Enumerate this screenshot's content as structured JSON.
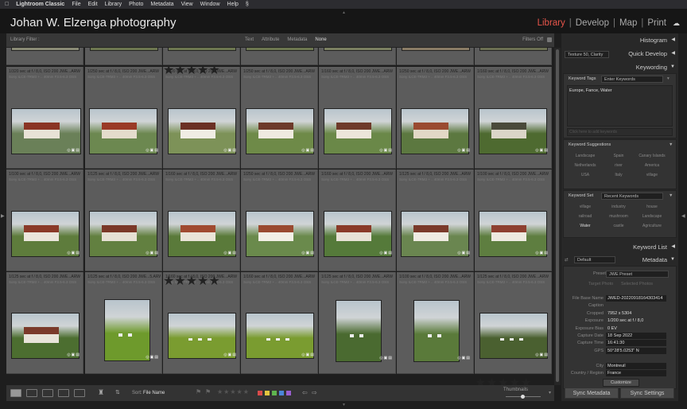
{
  "menubar": {
    "app": "Lightroom Classic",
    "items": [
      "File",
      "Edit",
      "Library",
      "Photo",
      "Metadata",
      "View",
      "Window",
      "Help"
    ]
  },
  "header": {
    "identity_plate": "Johan W. Elzenga photography",
    "modules": [
      "Library",
      "Develop",
      "Map",
      "Print"
    ],
    "separator": "|"
  },
  "filter_bar": {
    "label": "Library Filter :",
    "options": [
      "Text",
      "Attribute",
      "Metadata",
      "None"
    ],
    "selected": "None",
    "filters_off": "Filters Off"
  },
  "grid_rows": [
    {
      "meta1": "",
      "meta2": "",
      "cells": [
        {
          "stars": "",
          "bg": "#8a8b76"
        },
        {
          "stars": "",
          "bg": "#6d7750"
        },
        {
          "stars": "★★★★★",
          "bg": "#6d7750"
        },
        {
          "stars": "",
          "bg": "#6d7750"
        },
        {
          "stars": "",
          "bg": "#7b8061"
        },
        {
          "stars": "",
          "bg": "#8a7c66"
        },
        {
          "stars": "",
          "bg": "#6b6f52"
        }
      ]
    },
    {
      "cells": [
        {
          "meta1": "1/320 sec at f / 8,0, ISO 200",
          "code": "JWE...ARW",
          "meta2": "Sony ILCE-7RM3 + .. 40mm F3.5-6.3 OSS",
          "bg": "#6a8058",
          "roof": "#8a3424",
          "wall": "#e8e2d6"
        },
        {
          "meta1": "1/250 sec at f / 8,0, ISO 200",
          "code": "JWE...ARW",
          "meta2": "Sony ILCE-7RM3 + .. 40mm F3.5-6.3 OSS",
          "bg": "#6c8850",
          "roof": "#9a3a26",
          "wall": "#e4dccc"
        },
        {
          "meta1": "1/320 sec at f / 8,0, ISO 200",
          "code": "JWE...ARW",
          "meta2": "Sony ILCE-7RM3 + .. 40mm F3.5-6.3 OSS",
          "bg": "#7d9258",
          "roof": "#6b3024",
          "wall": "#f0ede4"
        },
        {
          "meta1": "1/250 sec at f / 8,0, ISO 200",
          "code": "JWE...ARW",
          "meta2": "Sony ILCE-7RM3 + .. 40mm F3.5-6.3 OSS",
          "bg": "#6e8a48",
          "roof": "#6d3a2a",
          "wall": "#efeae0"
        },
        {
          "meta1": "1/160 sec at f / 8,0, ISO 200",
          "code": "JWE...ARW",
          "meta2": "Sony ILCE-7RM3 + .. 40mm F3.5-6.3 OSS",
          "bg": "#6a8848",
          "roof": "#6e3a2a",
          "wall": "#ece6da"
        },
        {
          "meta1": "1/250 sec at f / 8,0, ISO 200",
          "code": "JWE...ARW",
          "meta2": "Sony ILCE-7RM3 + .. 40mm F3.5-6.3 OSS",
          "bg": "#5c7840",
          "roof": "#9a4a30",
          "wall": "#e2d8c6"
        },
        {
          "meta1": "1/160 sec at f / 8,0, ISO 200",
          "code": "JWE...ARW",
          "meta2": "Sony ILCE-7RM3 + .. 40mm F3.5-6.3 OSS",
          "bg": "#4e6a30",
          "roof": "#4a4a3a",
          "wall": "#dad5c8"
        }
      ]
    },
    {
      "cells": [
        {
          "meta1": "1/100 sec at f / 8,0, ISO 200",
          "code": "JWE...ARW",
          "meta2": "Sony ILCE-7RM3 + .. 40mm F3.5-6.3 OSS",
          "bg": "#5e7c3c",
          "roof": "#8a3a28",
          "wall": "#ebe6dc"
        },
        {
          "meta1": "1/125 sec at f / 8,0, ISO 200",
          "code": "JWE...ARW",
          "meta2": "Sony ILCE-7RM3 + .. 40mm F3.5-6.3 OSS",
          "bg": "#628040",
          "roof": "#7a3828",
          "wall": "#e6e0d4"
        },
        {
          "meta1": "1/160 sec at f / 8,0, ISO 200",
          "code": "JWE...ARW",
          "meta2": "Sony ILCE-7RM3 + .. 40mm F3.5-6.3 OSS",
          "bg": "#5a7a3a",
          "roof": "#a04a30",
          "wall": "#eae4d8"
        },
        {
          "meta1": "1/250 sec at f / 8,0, ISO 200",
          "code": "JWE...ARW",
          "meta2": "Sony ILCE-7RM3 + .. 40mm F3.5-6.3 OSS",
          "bg": "#6a8a4c",
          "roof": "#9a4a30",
          "wall": "#f2efe6"
        },
        {
          "meta1": "1/160 sec at f / 8,0, ISO 200",
          "code": "JWE...ARW",
          "meta2": "Sony ILCE-7RM3 + .. 40mm F3.5-6.3 OSS",
          "bg": "#557a3a",
          "roof": "#8a3a28",
          "wall": "#e8e2d6"
        },
        {
          "meta1": "1/125 sec at f / 8,0, ISO 200",
          "code": "JWE...ARW",
          "meta2": "Sony ILCE-7RM3 + .. 40mm F3.5-6.3 OSS",
          "bg": "#6a8650",
          "roof": "#7a3a2a",
          "wall": "#efebe2"
        },
        {
          "meta1": "1/100 sec at f / 8,0, ISO 200",
          "code": "JWE...ARW",
          "meta2": "Sony ILCE-7RM3 + .. 40mm F3.5-6.3 OSS",
          "bg": "#5e7e40",
          "roof": "#8e4030",
          "wall": "#eeeae0"
        }
      ]
    },
    {
      "cells": [
        {
          "meta1": "1/125 sec at f / 8,0, ISO 200",
          "code": "JWE...ARW",
          "meta2": "Sony ILCE-7RM3 + .. 40mm F3.5-6.3 OSS",
          "bg": "#4c6e30",
          "roof": "#7a3a2a",
          "wall": "#e8e4da"
        },
        {
          "meta1": "1/125 sec at f / 8,0, ISO 200",
          "code": "JWE...5.ARW",
          "meta2": "Sony ILCE-7RM3 + .. 40mm F3.5-6.3 OSS",
          "bg": "#6e9a2c"
        },
        {
          "meta1": "1/160 sec at f / 8,0, ISO 200",
          "code": "JWE...ARW",
          "meta2": "Sony ILCE-7RM3 + .. 40mm F3.5-6.3 OSS",
          "bg": "#7a9c30"
        },
        {
          "meta1": "1/160 sec at f / 8,0, ISO 200",
          "code": "JWE...ARW",
          "meta2": "Sony ILCE-7RM3 + .. 40mm F3.5-6.3 OSS",
          "bg": "#7a9c30"
        },
        {
          "meta1": "1/125 sec at f / 8,0, ISO 200",
          "code": "JWE...ARW",
          "meta2": "Sony ILCE-7RM3 + .. 40mm F3.5-6.3 OSS",
          "bg": "#4a6a30"
        },
        {
          "meta1": "1/100 sec at f / 8,0, ISO 200",
          "code": "JWE...ARW",
          "meta2": "Sony ILCE-7RM3 + .. 40mm F3.5-6.3 OSS",
          "bg": "#5a7a3a"
        },
        {
          "meta1": "1/125 sec at f / 8,0, ISO 200",
          "code": "JWE...ARW",
          "meta2": "Sony ILCE-7RM3 + .. 40mm F3.5-6.3 OSS",
          "bg": "#4a6030"
        }
      ]
    }
  ],
  "row_stars": [
    "",
    "",
    "★★★★★",
    ""
  ],
  "last_row_stars": "★★★★★",
  "right_panel": {
    "histogram": "Histogram",
    "quick_develop": "Quick Develop",
    "quick_develop_preset": "Texture 50, Clarity",
    "keywording": "Keywording",
    "keyword_tags_label": "Keyword Tags",
    "keyword_tags_mode": "Enter Keywords",
    "keywords_text": "Europe, Fance, Water",
    "add_keywords_placeholder": "Click here to add keywords",
    "suggestions_label": "Keyword Suggestions",
    "suggestions": [
      "Landscape",
      "Spain",
      "Canary Islands",
      "Netherlands",
      "river",
      "America",
      "USA",
      "Italy",
      "village"
    ],
    "keyword_set_label": "Keyword Set",
    "keyword_set_value": "Recent Keywords",
    "keyword_set": [
      "village",
      "industry",
      "house",
      "railroad",
      "mushroom",
      "Landscape",
      "Water",
      "castle",
      "Agriculture"
    ],
    "keyword_list": "Keyword List",
    "metadata": "Metadata",
    "metadata_view": "Default",
    "preset_label": "Preset",
    "preset_value": "JWE Preset",
    "target_photo": "Target Photo",
    "selected_photos": "Selected Photos",
    "fields": [
      {
        "k": "File Base Name",
        "v": "JWED-20220918164303414"
      },
      {
        "k": "Caption",
        "v": ""
      },
      {
        "k": "Cropped",
        "v": "7952 x 5304"
      },
      {
        "k": "Exposure",
        "v": "1/200 sec at f / 8,0"
      },
      {
        "k": "Exposure Bias",
        "v": "0 EV"
      },
      {
        "k": "Capture Date",
        "v": "18 Sep 2022"
      },
      {
        "k": "Capture Time",
        "v": "16:41:30"
      },
      {
        "k": "GPS",
        "v": "50°28'5.0253\" N"
      },
      {
        "k": "",
        "v": ""
      },
      {
        "k": "City",
        "v": "Montreuil"
      },
      {
        "k": "Country / Region",
        "v": "France"
      }
    ],
    "customize": "Customize",
    "sync_metadata": "Sync Metadata",
    "sync_settings": "Sync Settings"
  },
  "toolbar": {
    "sort_label": "Sort:",
    "sort_value": "File Name",
    "thumbnails_label": "Thumbnails"
  },
  "colors": {
    "accent_module": "#e8554a",
    "labels": [
      "#d94b4b",
      "#e3c53f",
      "#5fb54f",
      "#4c86d9",
      "#9a5fd0"
    ]
  }
}
